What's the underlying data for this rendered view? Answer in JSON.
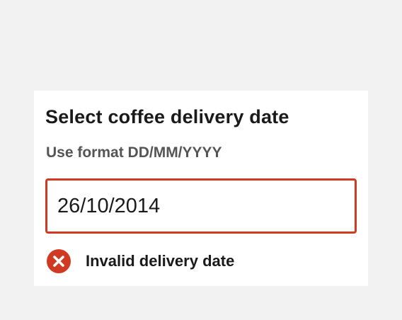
{
  "form": {
    "title": "Select coffee delivery date",
    "hint": "Use format DD/MM/YYYY",
    "date_value": "26/10/2014",
    "error_message": "Invalid delivery date"
  },
  "colors": {
    "page_background": "#f2f2f2",
    "card_background": "#ffffff",
    "error": "#d13a22",
    "text": "#1a1a1a",
    "hint_text": "#555555"
  },
  "icons": {
    "error": "error-x-circle-icon"
  }
}
